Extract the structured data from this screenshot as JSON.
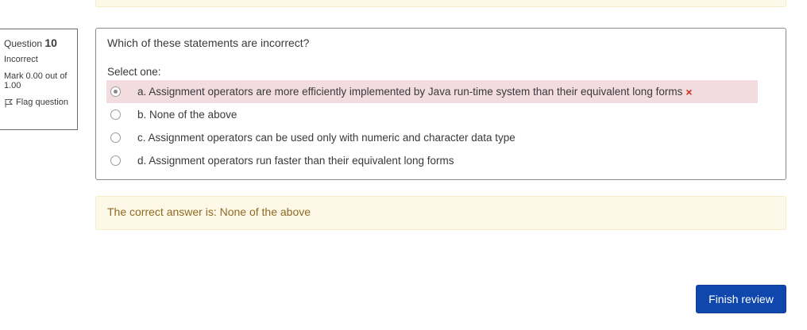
{
  "question_info": {
    "prefix": "Question",
    "number": "10",
    "state": "Incorrect",
    "grade": "Mark 0.00 out of 1.00",
    "flag_label": "Flag question",
    "flag_icon": "flag-icon"
  },
  "question": {
    "text": "Which of these statements are incorrect?",
    "prompt": "Select one:",
    "answers": [
      {
        "label": "a. Assignment operators are more efficiently implemented by Java run-time system than their equivalent long forms",
        "checked": true,
        "status": "incorrect"
      },
      {
        "label": "b. None of the above",
        "checked": false
      },
      {
        "label": "c. Assignment operators can be used only with numeric and character data type",
        "checked": false
      },
      {
        "label": "d. Assignment operators run faster than their equivalent long forms",
        "checked": false
      }
    ],
    "incorrect_mark": "×"
  },
  "feedback": {
    "right_answer": "The correct answer is: None of the above"
  },
  "footer": {
    "finish_label": "Finish review"
  },
  "colors": {
    "feedback_bg": "#fdf8e8",
    "incorrect_bg": "#f3dcdf",
    "incorrect_mark": "#ca3120",
    "primary_button": "#0f47ad"
  }
}
